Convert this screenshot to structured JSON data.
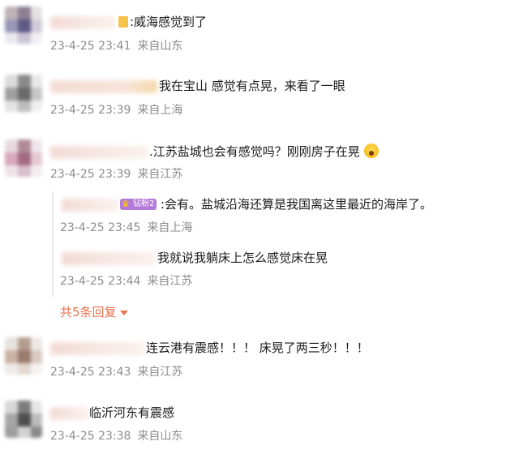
{
  "comments": [
    {
      "text": ":威海感觉到了",
      "time": "23-4-25 23:41",
      "location": "来自山东"
    },
    {
      "text": "我在宝山 感觉有点晃，来看了一眼",
      "time": "23-4-25 23:39",
      "location": "来自上海"
    },
    {
      "text": ".江苏盐城也会有感觉吗？刚刚房子在晃",
      "time": "23-4-25 23:39",
      "location": "来自江苏",
      "replies": [
        {
          "badge": "钻粉2",
          "text": ":会有。盐城沿海还算是我国离这里最近的海岸了。",
          "time": "23-4-25 23:45",
          "location": "来自上海"
        },
        {
          "text": "我就说我躺床上怎么感觉床在晃",
          "time": "23-4-25 23:44",
          "location": "来自江苏"
        }
      ],
      "more_replies": "共5条回复"
    },
    {
      "text": "连云港有震感！！！ 床晃了两三秒！！！",
      "time": "23-4-25 23:43",
      "location": "来自江苏"
    },
    {
      "text": "临沂河东有震感",
      "time": "23-4-25 23:38",
      "location": "来自山东"
    }
  ],
  "colors": {
    "accent": "#eb7350",
    "meta": "#8c8c8c",
    "badge": "#b57ad8"
  },
  "icons": {
    "surprised_emoji": "astonished-face-emoji",
    "badge_icon": "crown-icon",
    "vip_icon": "vip-badge-icon"
  }
}
